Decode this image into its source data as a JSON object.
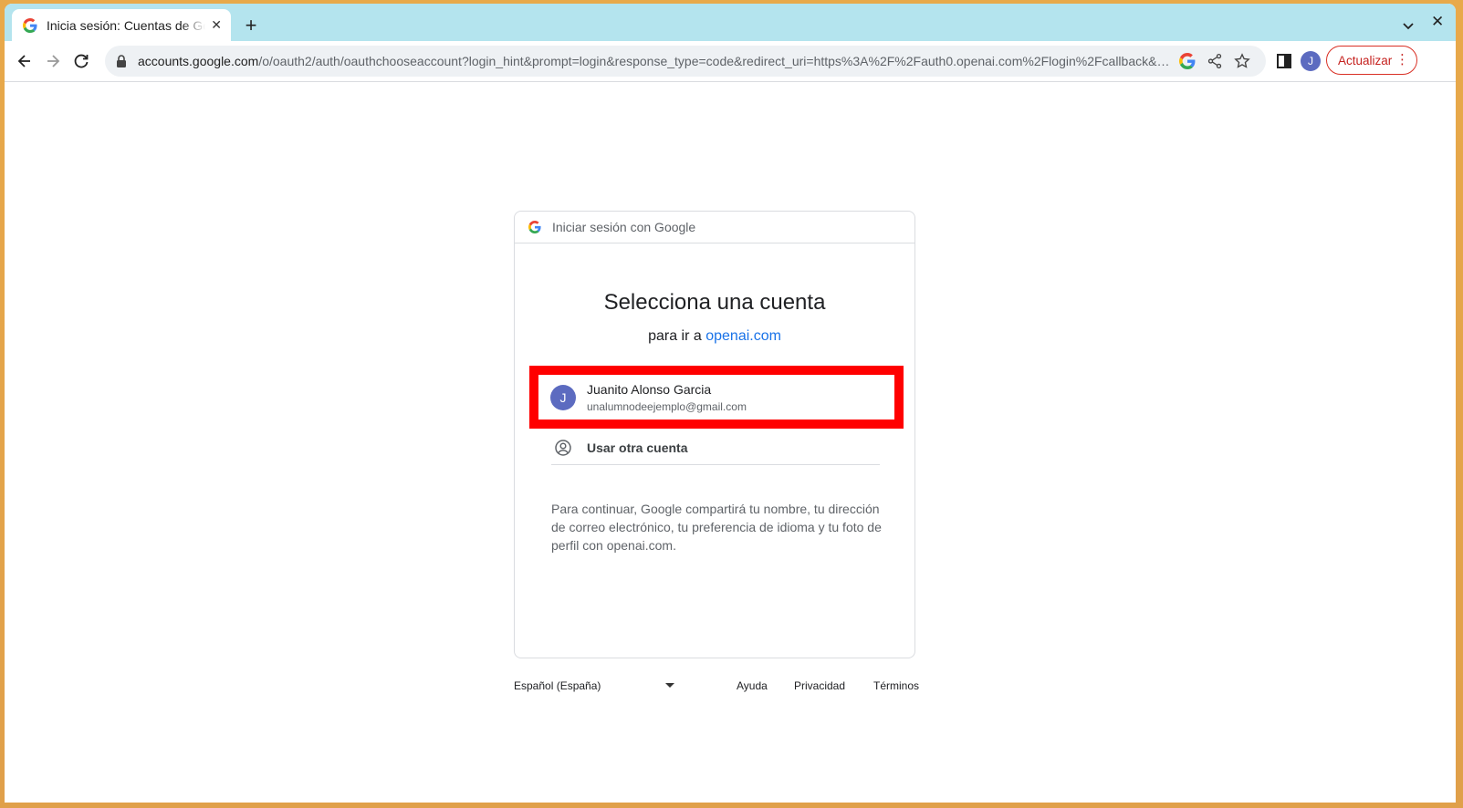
{
  "browser": {
    "tab_title": "Inicia sesión: Cuentas de Google",
    "new_tab_label": "+",
    "url_host": "accounts.google.com",
    "url_path": "/o/oauth2/auth/oauthchooseaccount?login_hint&prompt=login&response_type=code&redirect_uri=https%3A%2F%2Fauth0.openai.com%2Flogin%2Fcallback&sc...",
    "profile_initial": "J",
    "update_label": "Actualizar"
  },
  "card": {
    "header": "Iniciar sesión con Google",
    "title": "Selecciona una cuenta",
    "subtitle_prefix": "para ir a",
    "subtitle_link": "openai.com",
    "account": {
      "initial": "J",
      "name": "Juanito Alonso Garcia",
      "email": "unalumnodeejemplo@gmail.com"
    },
    "other_account": "Usar otra cuenta",
    "consent": "Para continuar, Google compartirá tu nombre, tu dirección de correo electrónico, tu preferencia de idioma y tu foto de perfil con openai.com."
  },
  "footer": {
    "language": "Español (España)",
    "help": "Ayuda",
    "privacy": "Privacidad",
    "terms": "Términos"
  },
  "colors": {
    "accent_link": "#1a73e8",
    "avatar": "#5c6bc0",
    "highlight": "#ff0000",
    "tabstrip": "#b4e4ee"
  }
}
